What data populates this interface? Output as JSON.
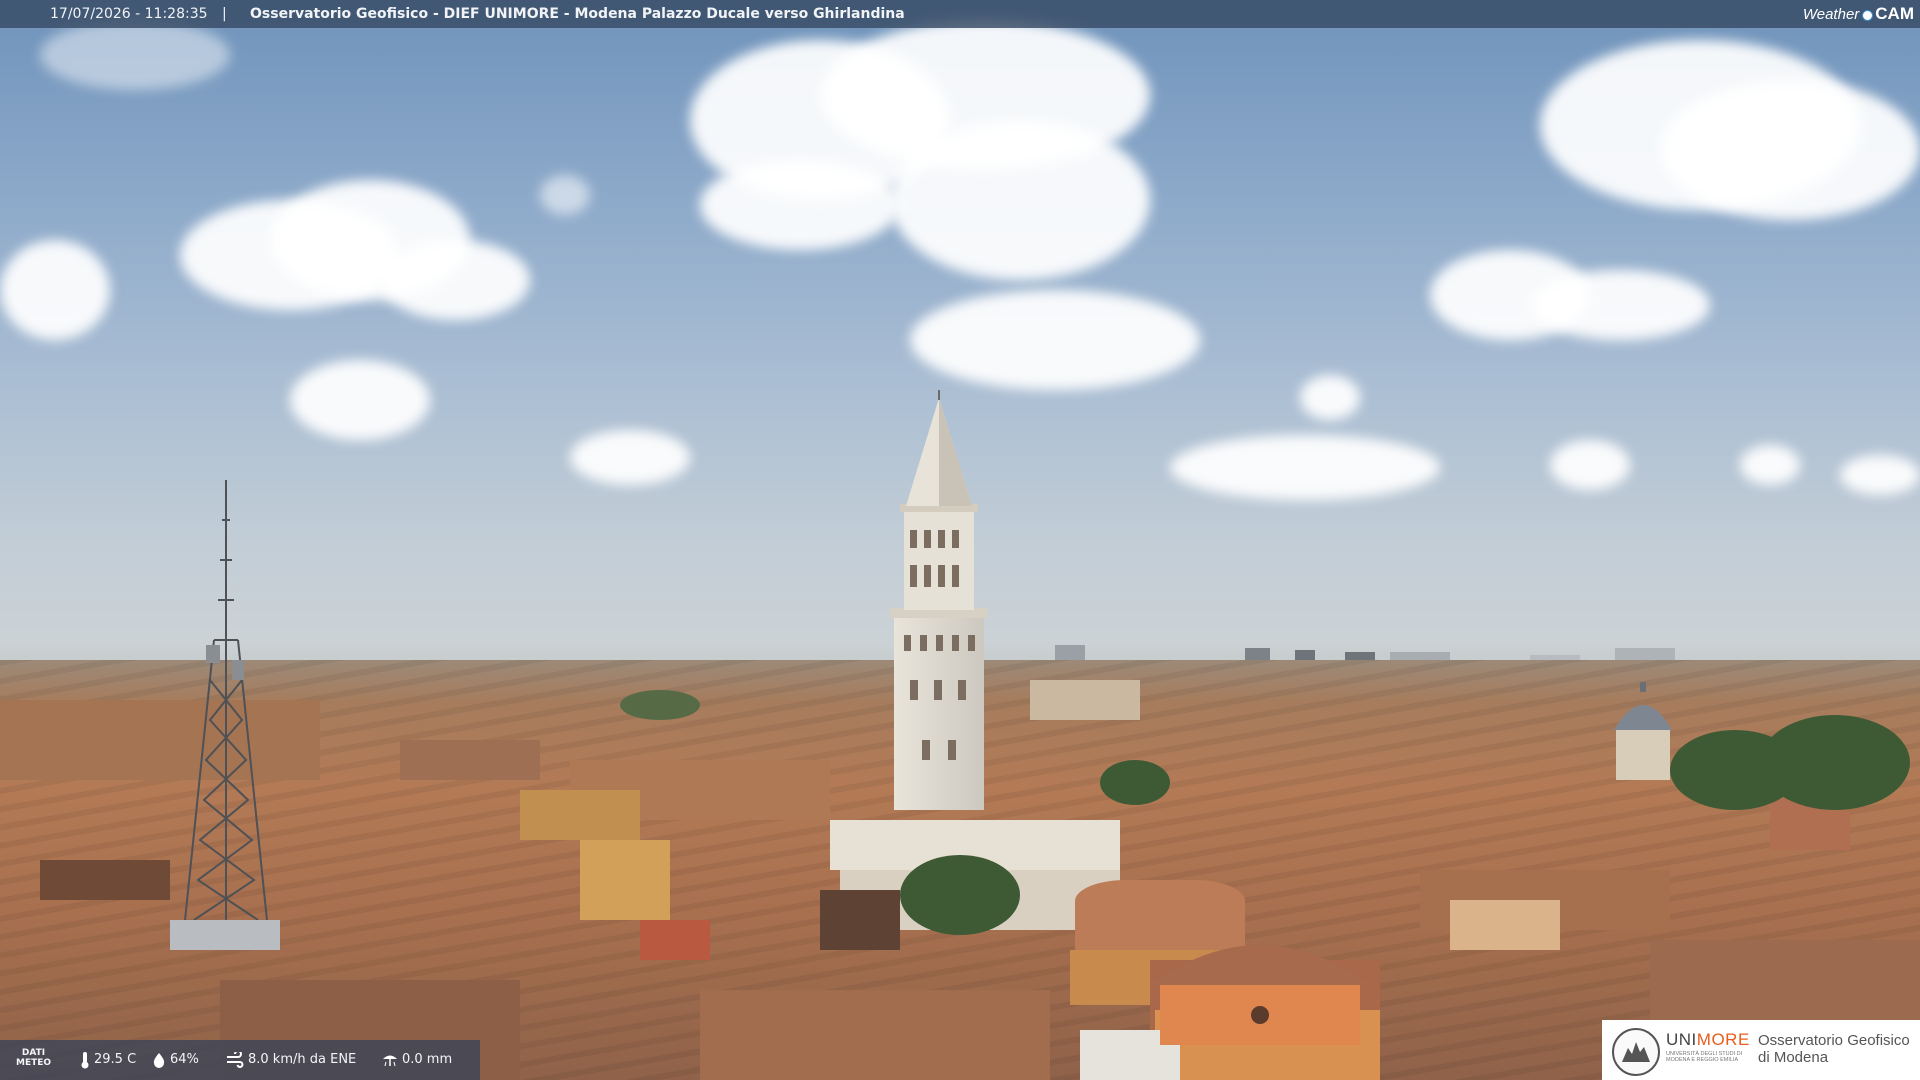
{
  "header": {
    "datetime": "17/07/2026 - 11:28:35",
    "separator": "|",
    "title": "Osservatorio Geofisico - DIEF UNIMORE - Modena Palazzo Ducale verso Ghirlandina"
  },
  "brand": {
    "word": "Weather",
    "suffix": "CAM",
    "icon": "weathercam-dot-icon"
  },
  "meteo": {
    "label_line1": "DATI",
    "label_line2": "METEO",
    "temperature": "29.5 C",
    "humidity": "64%",
    "wind": "8.0 km/h da ENE",
    "rain": "0.0 mm",
    "icons": [
      "thermometer-icon",
      "humidity-drop-icon",
      "wind-icon",
      "rain-icon"
    ]
  },
  "logo": {
    "uni": "UNI",
    "more": "MORE",
    "sub_line1": "UNIVERSITÀ DEGLI STUDI DI",
    "sub_line2": "MODENA E REGGIO EMILIA",
    "obs_line1": "Osservatorio Geofisico",
    "obs_line2": "di Modena",
    "accent": "#e85d1c"
  },
  "colors": {
    "sky_top": "#6f93bb",
    "roofs": "#b37a55"
  }
}
